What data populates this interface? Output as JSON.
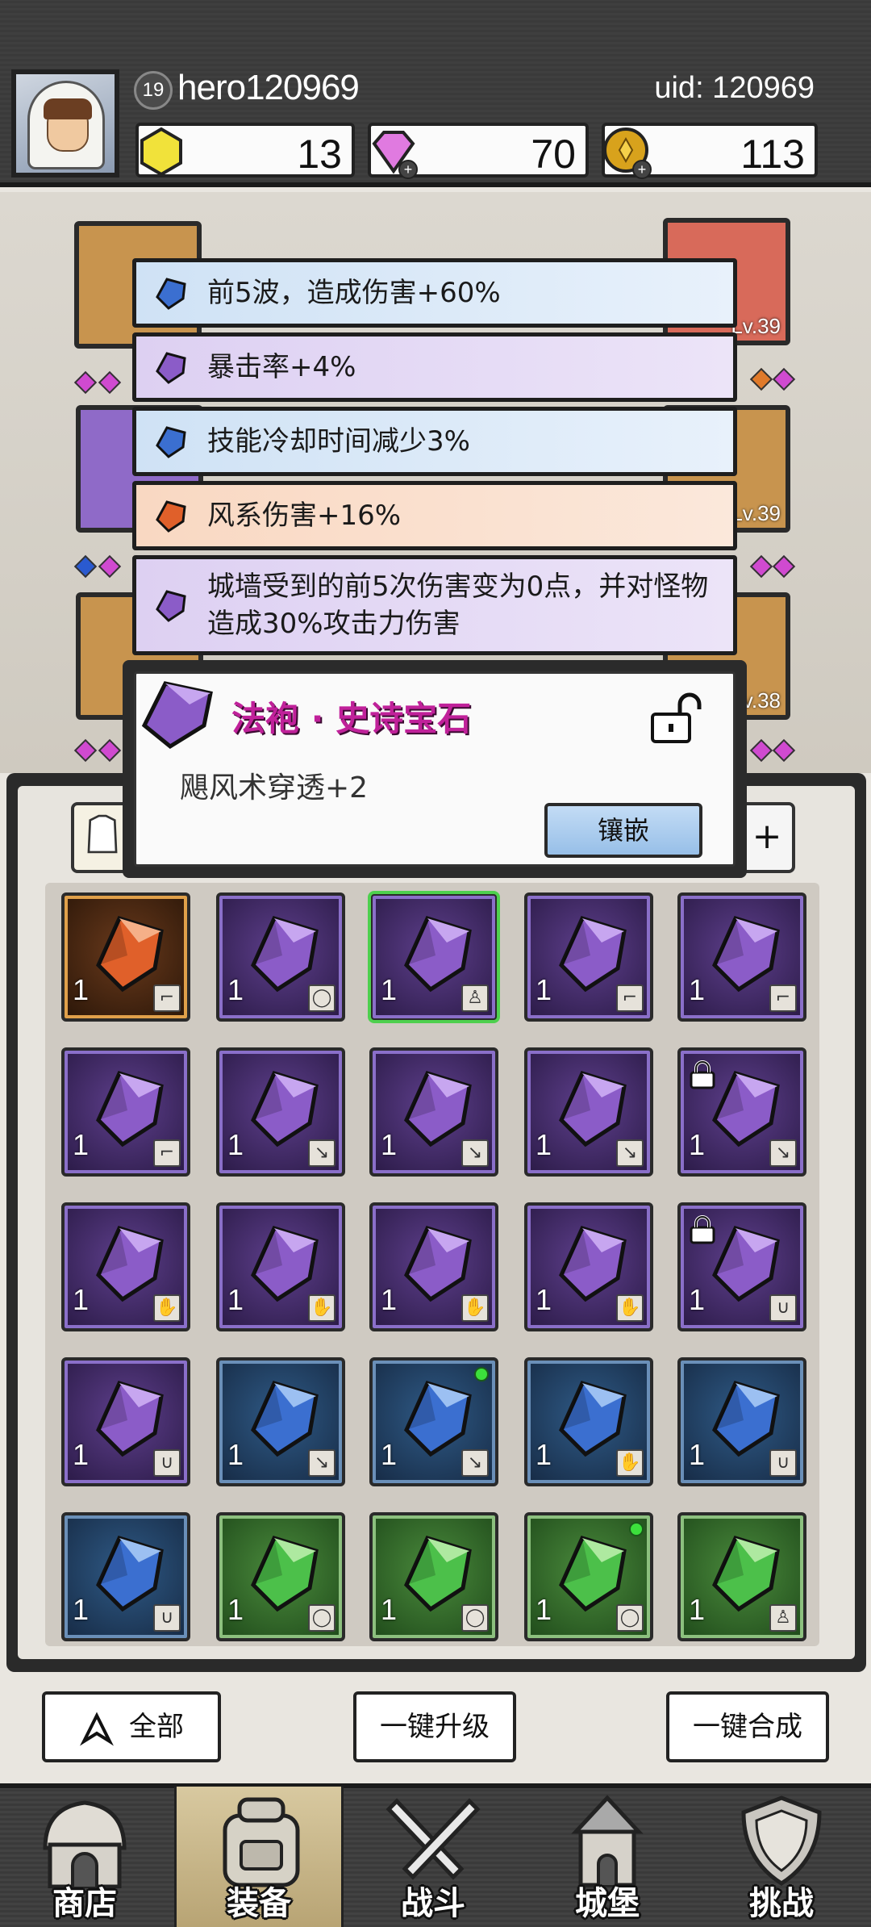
{
  "player": {
    "level": "19",
    "name": "hero120969",
    "uid": "uid: 120969"
  },
  "resources": [
    {
      "icon": "gold-hexagon-icon",
      "value": "13"
    },
    {
      "icon": "diamond-icon",
      "value": "70"
    },
    {
      "icon": "coin-icon",
      "value": "113"
    }
  ],
  "hero_slots": [
    {
      "level": "Lv.39"
    },
    {
      "level": "Lv.39"
    },
    {
      "level": "Lv.38"
    }
  ],
  "bonuses": [
    {
      "color": "blue",
      "text": "前5波，造成伤害+60%"
    },
    {
      "color": "purple",
      "text": "暴击率+4%"
    },
    {
      "color": "blue",
      "text": "技能冷却时间减少3%"
    },
    {
      "color": "orange",
      "text": "风系伤害+16%"
    },
    {
      "color": "purple",
      "text": "城墙受到的前5次伤害变为0点，并对怪物造成30%攻击力伤害"
    }
  ],
  "tooltip": {
    "title": "法袍 · 史诗宝石",
    "effect": "飓风术穿透+2",
    "button": "镶嵌"
  },
  "filter": {
    "plus": "+"
  },
  "inventory": [
    {
      "rarity": "orange",
      "count": "1",
      "slot": "boots"
    },
    {
      "rarity": "purple",
      "count": "1",
      "slot": "ring"
    },
    {
      "rarity": "purple",
      "count": "1",
      "slot": "robe",
      "selected": true
    },
    {
      "rarity": "purple",
      "count": "1",
      "slot": "boots"
    },
    {
      "rarity": "purple",
      "count": "1",
      "slot": "boots"
    },
    {
      "rarity": "purple",
      "count": "1",
      "slot": "boots"
    },
    {
      "rarity": "purple",
      "count": "1",
      "slot": "staff"
    },
    {
      "rarity": "purple",
      "count": "1",
      "slot": "staff"
    },
    {
      "rarity": "purple",
      "count": "1",
      "slot": "staff"
    },
    {
      "rarity": "purple",
      "count": "1",
      "slot": "staff",
      "locked": true
    },
    {
      "rarity": "purple",
      "count": "1",
      "slot": "gloves"
    },
    {
      "rarity": "purple",
      "count": "1",
      "slot": "gloves"
    },
    {
      "rarity": "purple",
      "count": "1",
      "slot": "gloves"
    },
    {
      "rarity": "purple",
      "count": "1",
      "slot": "gloves"
    },
    {
      "rarity": "purple",
      "count": "1",
      "slot": "necklace",
      "locked": true
    },
    {
      "rarity": "purple",
      "count": "1",
      "slot": "necklace"
    },
    {
      "rarity": "blue",
      "count": "1",
      "slot": "staff"
    },
    {
      "rarity": "blue",
      "count": "1",
      "slot": "staff",
      "dot": true
    },
    {
      "rarity": "blue",
      "count": "1",
      "slot": "gloves"
    },
    {
      "rarity": "blue",
      "count": "1",
      "slot": "necklace"
    },
    {
      "rarity": "blue",
      "count": "1",
      "slot": "necklace"
    },
    {
      "rarity": "green",
      "count": "1",
      "slot": "ring"
    },
    {
      "rarity": "green",
      "count": "1",
      "slot": "ring"
    },
    {
      "rarity": "green",
      "count": "1",
      "slot": "ring",
      "dot": true
    },
    {
      "rarity": "green",
      "count": "1",
      "slot": "robe"
    }
  ],
  "actions": {
    "all": "全部",
    "upgrade_all": "一键升级",
    "merge_all": "一键合成"
  },
  "nav": [
    {
      "label": "商店",
      "icon": "shop-icon"
    },
    {
      "label": "装备",
      "icon": "backpack-icon",
      "active": true
    },
    {
      "label": "战斗",
      "icon": "crossed-swords-icon"
    },
    {
      "label": "城堡",
      "icon": "castle-icon"
    },
    {
      "label": "挑战",
      "icon": "shield-icon"
    }
  ],
  "colors": {
    "purple_gem": "#8b5cc8",
    "blue_gem": "#3b6fd0",
    "green_gem": "#4cc04a",
    "orange_gem": "#e0602a",
    "tooltip_title": "#c0219a"
  }
}
